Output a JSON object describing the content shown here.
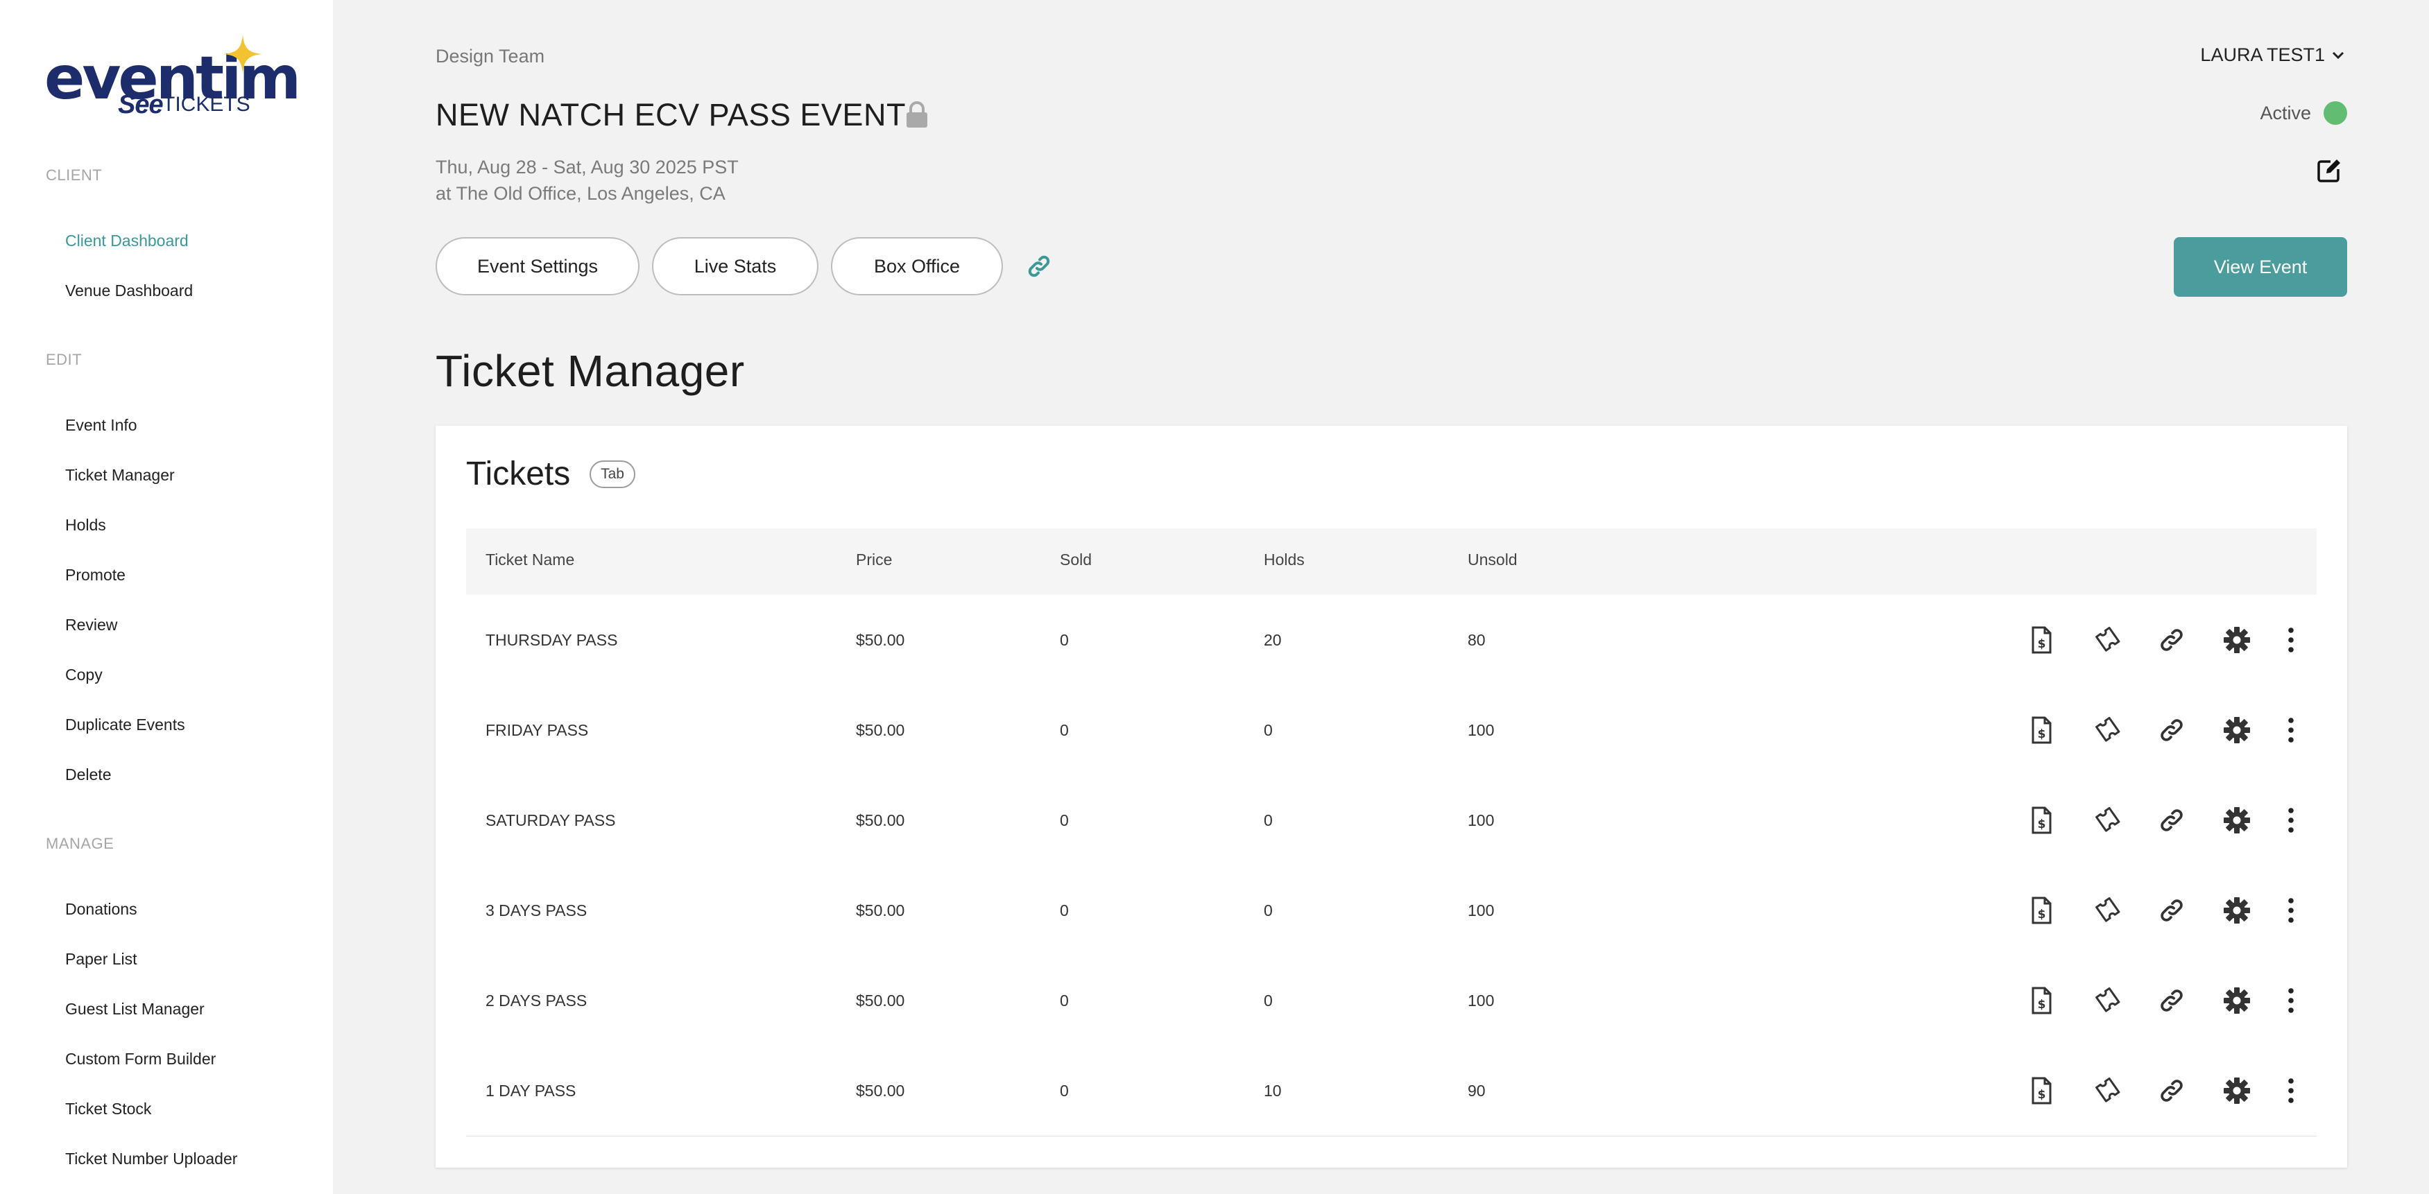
{
  "brand": {
    "logo_word": "eventim",
    "logo_see": "See",
    "logo_tickets": "TICKETS",
    "star_color": "#f2c230"
  },
  "sidebar": {
    "sections": [
      {
        "label": "CLIENT",
        "items": [
          {
            "label": "Client Dashboard",
            "active": true
          },
          {
            "label": "Venue Dashboard"
          }
        ]
      },
      {
        "label": "EDIT",
        "items": [
          {
            "label": "Event Info"
          },
          {
            "label": "Ticket Manager"
          },
          {
            "label": "Holds"
          },
          {
            "label": "Promote"
          },
          {
            "label": "Review"
          },
          {
            "label": "Copy"
          },
          {
            "label": "Duplicate Events"
          },
          {
            "label": "Delete"
          }
        ]
      },
      {
        "label": "MANAGE",
        "items": [
          {
            "label": "Donations"
          },
          {
            "label": "Paper List"
          },
          {
            "label": "Guest List Manager"
          },
          {
            "label": "Custom Form Builder"
          },
          {
            "label": "Ticket Stock"
          },
          {
            "label": "Ticket Number Uploader"
          }
        ]
      }
    ]
  },
  "header": {
    "org_name": "Design Team",
    "event_title": "NEW NATCH ECV PASS EVENT",
    "event_dates": "Thu, Aug 28 - Sat, Aug 30 2025 PST",
    "event_venue": "at The Old Office, Los Angeles, CA",
    "user_name": "LAURA TEST1",
    "status_label": "Active",
    "status_color": "#62bd73",
    "buttons": {
      "event_settings": "Event Settings",
      "live_stats": "Live Stats",
      "box_office": "Box Office",
      "view_event": "View Event"
    },
    "accent_color": "#4a9d9c"
  },
  "page_heading": "Ticket Manager",
  "tickets": {
    "title": "Tickets",
    "badge": "Tab",
    "columns": [
      "Ticket Name",
      "Price",
      "Sold",
      "Holds",
      "Unsold"
    ],
    "rows": [
      {
        "name": "THURSDAY PASS",
        "price": "$50.00",
        "sold": "0",
        "holds": "20",
        "unsold": "80"
      },
      {
        "name": "FRIDAY PASS",
        "price": "$50.00",
        "sold": "0",
        "holds": "0",
        "unsold": "100"
      },
      {
        "name": "SATURDAY PASS",
        "price": "$50.00",
        "sold": "0",
        "holds": "0",
        "unsold": "100"
      },
      {
        "name": "3 DAYS PASS",
        "price": "$50.00",
        "sold": "0",
        "holds": "0",
        "unsold": "100"
      },
      {
        "name": "2 DAYS PASS",
        "price": "$50.00",
        "sold": "0",
        "holds": "0",
        "unsold": "100"
      },
      {
        "name": "1 DAY PASS",
        "price": "$50.00",
        "sold": "0",
        "holds": "10",
        "unsold": "90"
      }
    ],
    "row_action_icons": [
      "invoice-icon",
      "ticket-icon",
      "link-icon",
      "gear-icon",
      "more-vertical-icon"
    ]
  }
}
